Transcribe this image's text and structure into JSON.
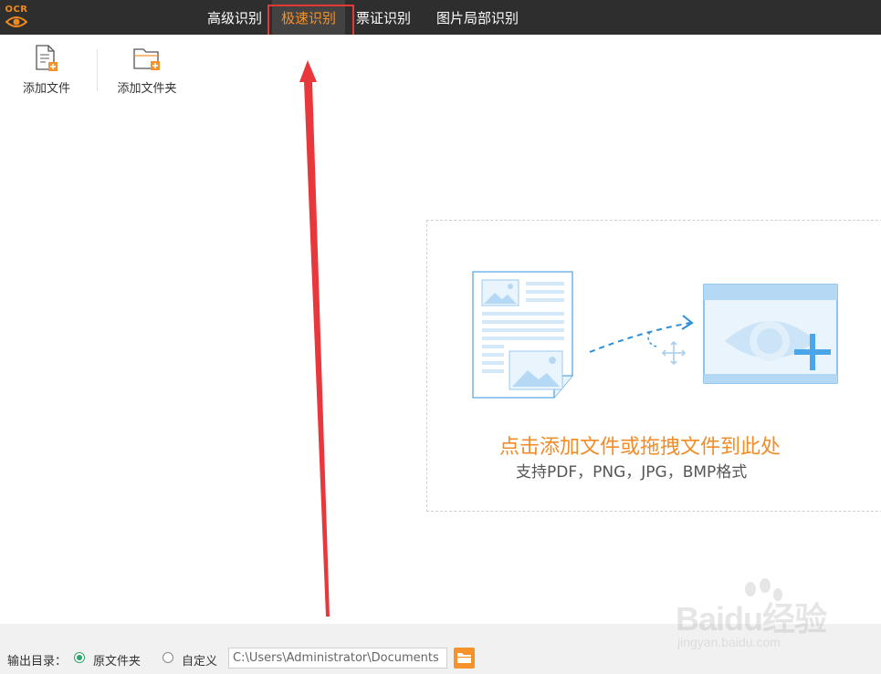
{
  "app": {
    "logo_text": "OCR"
  },
  "tabs": [
    {
      "label": "高级识别",
      "active": false
    },
    {
      "label": "极速识别",
      "active": true
    },
    {
      "label": "票证识别",
      "active": false
    },
    {
      "label": "图片局部识别",
      "active": false
    }
  ],
  "toolbar": {
    "add_file_label": "添加文件",
    "add_folder_label": "添加文件夹"
  },
  "dropzone": {
    "main_text": "点击添加文件或拖拽文件到此处",
    "sub_text": "支持PDF，PNG，JPG，BMP格式"
  },
  "footer": {
    "output_label": "输出目录：",
    "option_original": "原文件夹",
    "option_custom": "自定义",
    "selected": "原文件夹",
    "path_value": "C:\\Users\\Administrator\\Documents"
  },
  "watermark": {
    "brand": "Baidu经验",
    "url": "jingyan.baidu.com"
  },
  "colors": {
    "topbar": "#2e2e2e",
    "accent_orange": "#f5922a",
    "highlight_red": "#e53935",
    "radio_green": "#2fa56b",
    "illustration_blue": "#5aa9e6"
  }
}
